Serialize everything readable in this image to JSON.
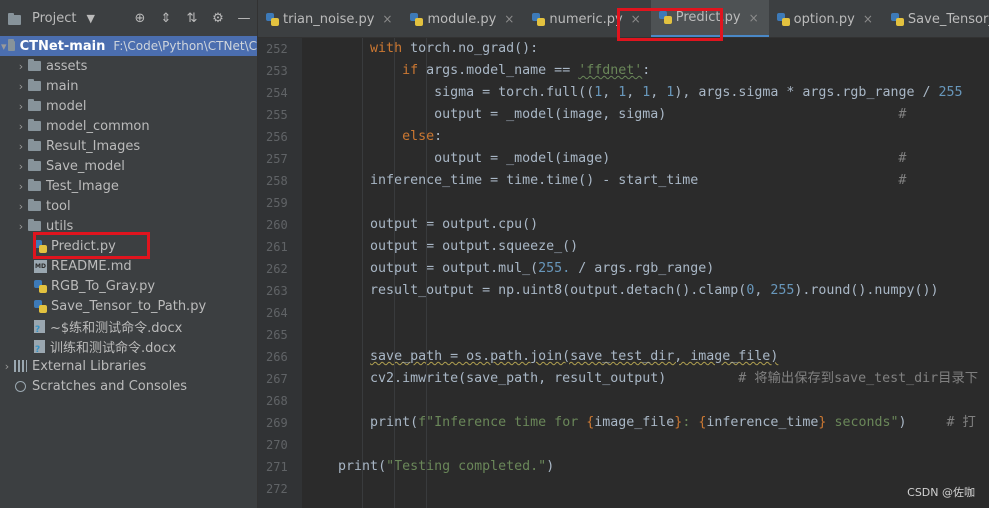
{
  "project_panel": {
    "title": "Project",
    "root": {
      "name": "CTNet-main",
      "path": "F:\\Code\\Python\\CTNet\\C"
    },
    "folders": [
      "assets",
      "main",
      "model",
      "model_common",
      "Result_Images",
      "Save_model",
      "Test_Image",
      "tool",
      "utils"
    ],
    "files": [
      {
        "name": "Predict.py",
        "icon": "python-file-icon"
      },
      {
        "name": "README.md",
        "icon": "markdown-file-icon"
      },
      {
        "name": "RGB_To_Gray.py",
        "icon": "python-file-icon"
      },
      {
        "name": "Save_Tensor_to_Path.py",
        "icon": "python-file-icon"
      },
      {
        "name": "~$练和测试命令.docx",
        "icon": "unknown-file-icon"
      },
      {
        "name": "训练和测试命令.docx",
        "icon": "unknown-file-icon"
      }
    ],
    "external_libraries": "External Libraries",
    "scratches": "Scratches and Consoles"
  },
  "tabs": [
    {
      "label": "trian_noise.py",
      "active": false
    },
    {
      "label": "module.py",
      "active": false
    },
    {
      "label": "numeric.py",
      "active": false
    },
    {
      "label": "Predict.py",
      "active": true
    },
    {
      "label": "option.py",
      "active": false
    },
    {
      "label": "Save_Tensor_to_Path.py",
      "active": false
    }
  ],
  "line_numbers": [
    "252",
    "253",
    "254",
    "255",
    "256",
    "257",
    "258",
    "259",
    "260",
    "261",
    "262",
    "263",
    "264",
    "265",
    "266",
    "267",
    "268",
    "269",
    "270",
    "271",
    "272"
  ],
  "watermark": "CSDN @佐咖",
  "colors": {
    "accent": "#4a88c7",
    "highlight_box": "#e0141e",
    "selection": "#0d293e"
  }
}
